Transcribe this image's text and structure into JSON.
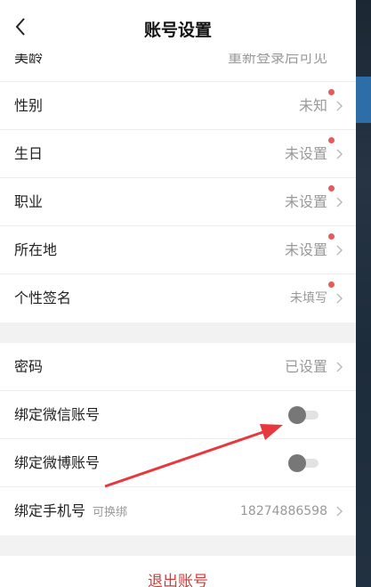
{
  "header": {
    "title": "账号设置",
    "back_icon": "chevron-left-icon"
  },
  "profile_rows": [
    {
      "label": "美龄",
      "value": "重新登录后可见",
      "dot": false,
      "chevron": false
    },
    {
      "label": "性别",
      "value": "未知",
      "dot": true,
      "chevron": true
    },
    {
      "label": "生日",
      "value": "未设置",
      "dot": true,
      "chevron": true
    },
    {
      "label": "职业",
      "value": "未设置",
      "dot": true,
      "chevron": true
    },
    {
      "label": "所在地",
      "value": "未设置",
      "dot": true,
      "chevron": true
    },
    {
      "label": "个性签名",
      "value": "未填写",
      "dot": true,
      "chevron": true
    }
  ],
  "account_rows": {
    "password": {
      "label": "密码",
      "value": "已设置"
    },
    "wechat": {
      "label": "绑定微信账号",
      "enabled": false
    },
    "weibo": {
      "label": "绑定微博账号",
      "enabled": false
    },
    "phone": {
      "label": "绑定手机号",
      "hint": "可换绑",
      "value": "18274886598"
    }
  },
  "logout": {
    "label": "退出账号"
  },
  "colors": {
    "dot": "#e35b5b",
    "logout": "#d23b3b",
    "arrow": "#e8383d"
  }
}
